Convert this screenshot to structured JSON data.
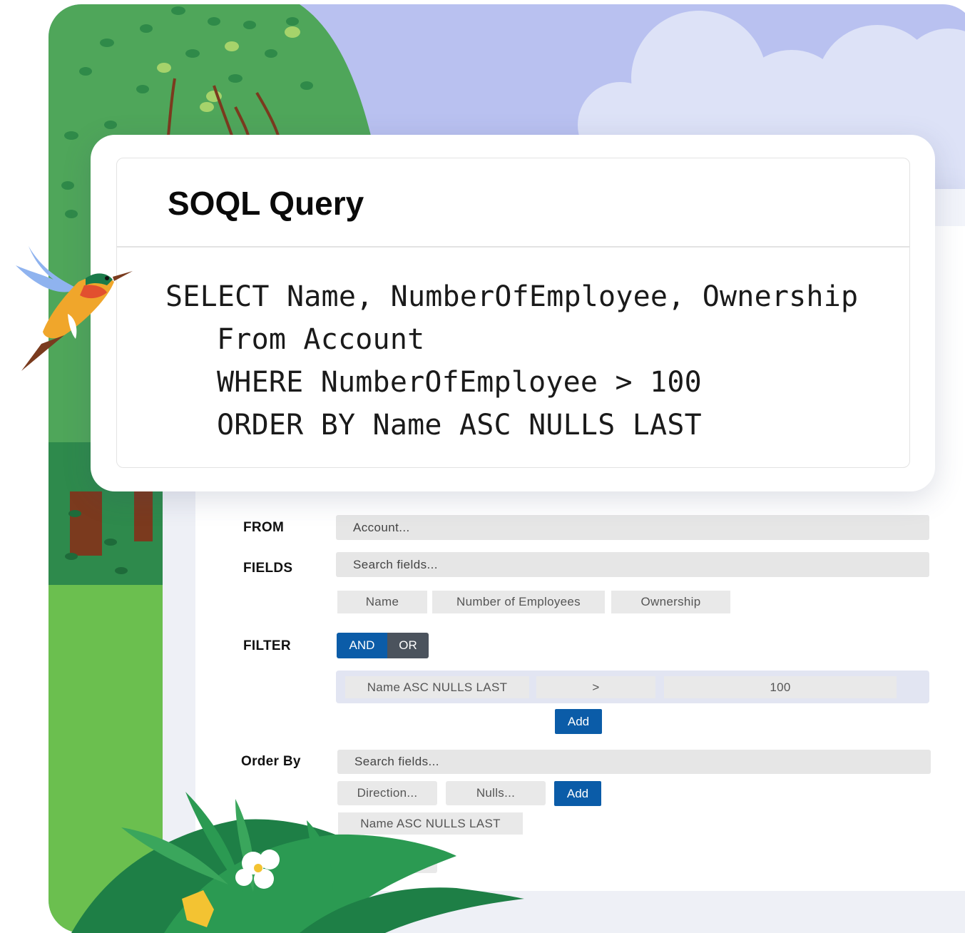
{
  "card": {
    "title": "SOQL Query",
    "code_lines": [
      "SELECT Name, NumberOfEmployee, Ownership",
      "From Account",
      "WHERE NumberOfEmployee > 100",
      "ORDER BY Name ASC NULLS LAST"
    ]
  },
  "builder": {
    "from": {
      "label": "FROM",
      "placeholder": "Account..."
    },
    "fields": {
      "label": "FIELDS",
      "placeholder": "Search fields...",
      "chips": [
        "Name",
        "Number of Employees",
        "Ownership"
      ]
    },
    "filter": {
      "label": "FILTER",
      "and_label": "AND",
      "or_label": "OR",
      "field": "Name ASC NULLS LAST",
      "operator": ">",
      "value": "100",
      "add_label": "Add"
    },
    "order_by": {
      "label": "Order By",
      "placeholder": "Search fields...",
      "direction_placeholder": "Direction...",
      "nulls_placeholder": "Nulls...",
      "add_label": "Add",
      "chip": "Name ASC NULLS LAST",
      "partial_field": "..."
    }
  },
  "colors": {
    "accent": "#0b5ca8",
    "toggle_dark": "#4b535d",
    "sky": "#b9c1f0",
    "tree_green": "#4fa65a"
  },
  "illustration": {
    "icons": [
      "tree-icon",
      "cloud-icon",
      "hummingbird-icon",
      "fern-icon",
      "flower-icon"
    ]
  }
}
